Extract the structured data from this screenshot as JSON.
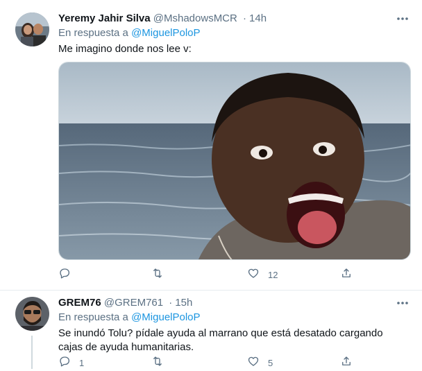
{
  "tweets": [
    {
      "author_name": "Yeremy Jahir Silva",
      "handle": "@MshadowsMCR",
      "separator": "·",
      "time": "14h",
      "reply_prefix": "En respuesta a",
      "reply_to": "@MiguelPoloP",
      "text": "Me imagino donde nos lee v:",
      "actions": {
        "reply_count": "",
        "retweet_count": "",
        "like_count": "12"
      }
    },
    {
      "author_name": "GREM76",
      "handle": "@GREM761",
      "separator": "·",
      "time": "15h",
      "reply_prefix": "En respuesta a",
      "reply_to": "@MiguelPoloP",
      "text": "Se inundó Tolu? pídale ayuda al marrano que está desatado cargando cajas de ayuda humanitarias.",
      "actions": {
        "reply_count": "1",
        "retweet_count": "",
        "like_count": "5"
      }
    }
  ],
  "colors": {
    "text": "#0f1419",
    "muted": "#5b7083",
    "link": "#1b95e0",
    "border": "#e6ecf0"
  }
}
